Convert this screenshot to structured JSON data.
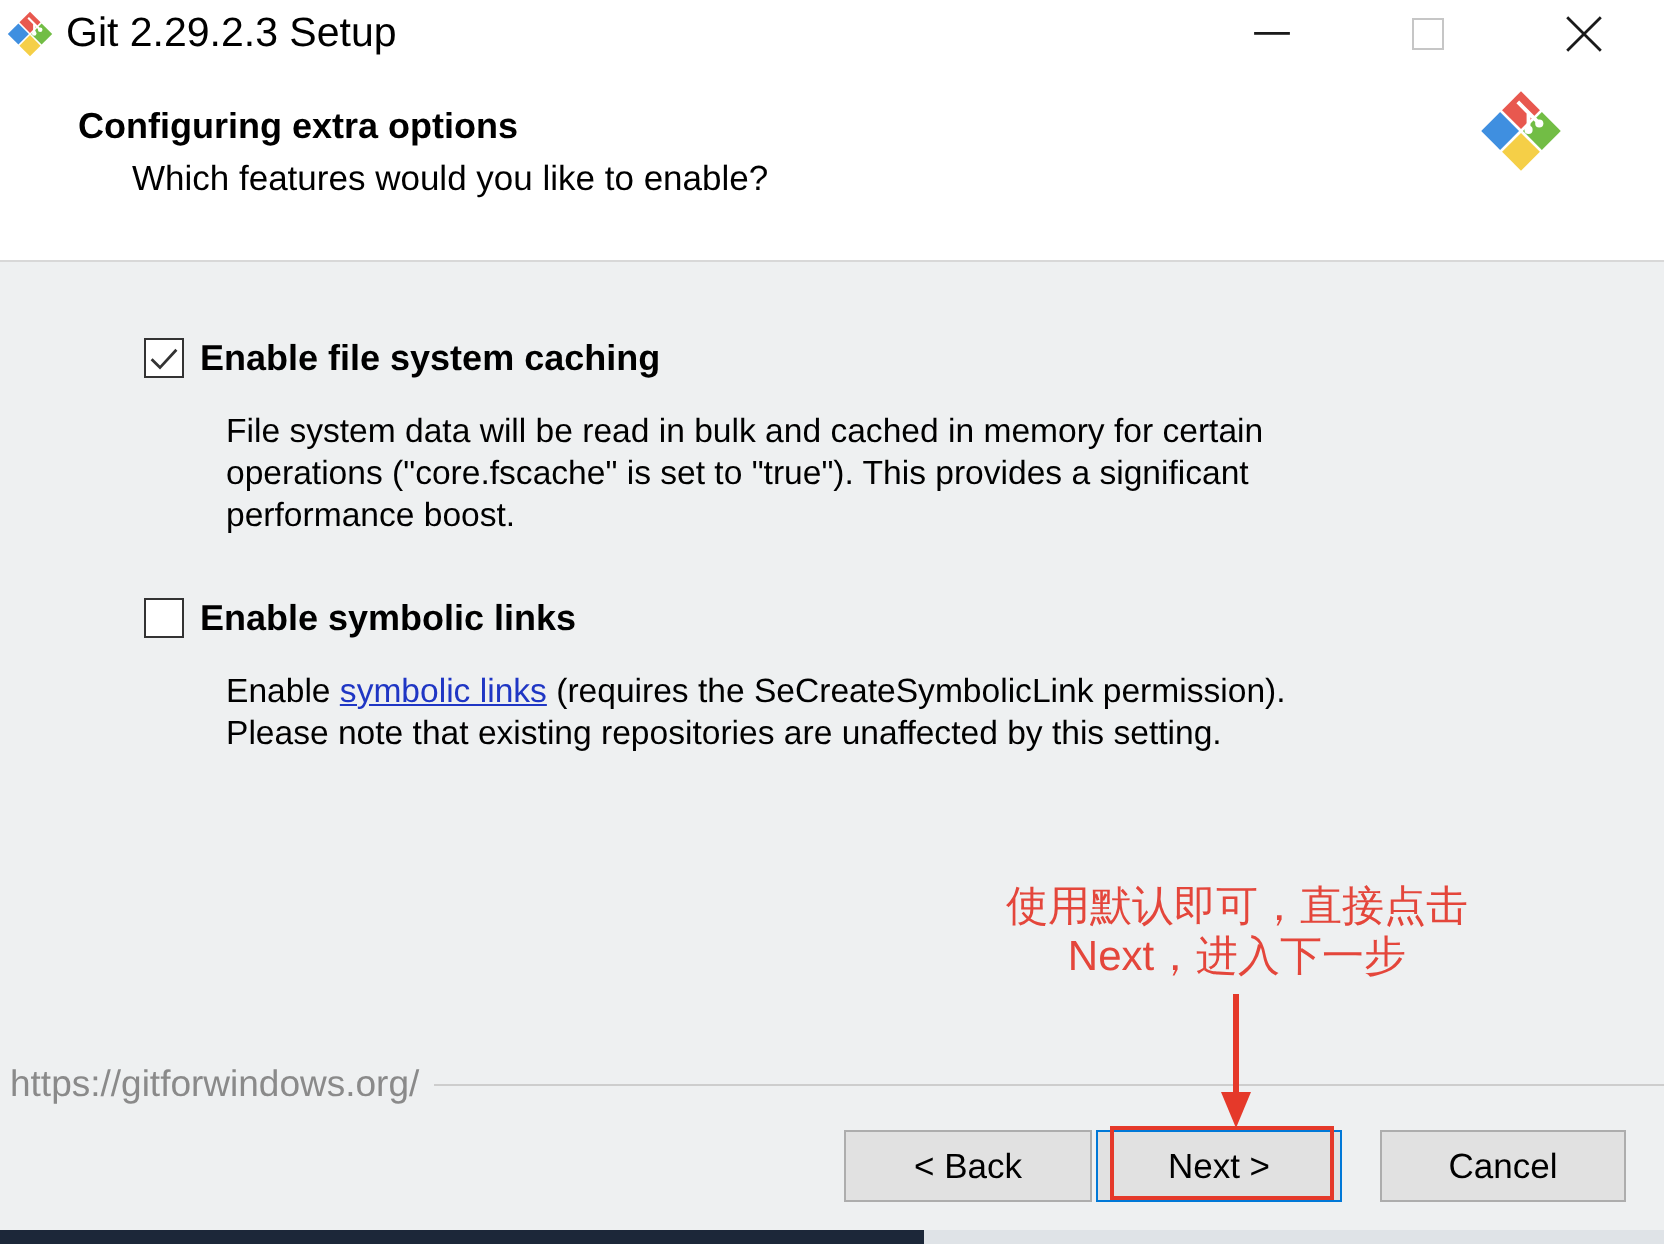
{
  "window": {
    "title": "Git 2.29.2.3 Setup",
    "controls": [
      {
        "kind": "minimize",
        "disabled": false
      },
      {
        "kind": "maximize",
        "disabled": true
      },
      {
        "kind": "close",
        "disabled": false
      }
    ]
  },
  "header": {
    "title": "Configuring extra options",
    "subtitle": "Which features would you like to enable?"
  },
  "options": [
    {
      "label": "Enable file system caching",
      "checked": true,
      "description": [
        {
          "kind": "text",
          "text": "File system data will be read in bulk and cached in memory for certain operations (\"core.fscache\" is set to \"true\"). This provides a significant performance boost."
        }
      ]
    },
    {
      "label": "Enable symbolic links",
      "checked": false,
      "description": [
        {
          "kind": "text",
          "text": "Enable "
        },
        {
          "kind": "link",
          "text": "symbolic links"
        },
        {
          "kind": "text",
          "text": " (requires the SeCreateSymbolicLink permission). Please note that existing repositories are unaffected by this setting."
        }
      ]
    }
  ],
  "footer": {
    "url": "https://gitforwindows.org/"
  },
  "buttons": [
    {
      "label": "< Back",
      "focused": false
    },
    {
      "label": "Next >",
      "focused": true
    },
    {
      "label": "Cancel",
      "focused": false
    }
  ],
  "annotation": {
    "text": "使用默认即可，直接点击Next，进入下一步"
  }
}
